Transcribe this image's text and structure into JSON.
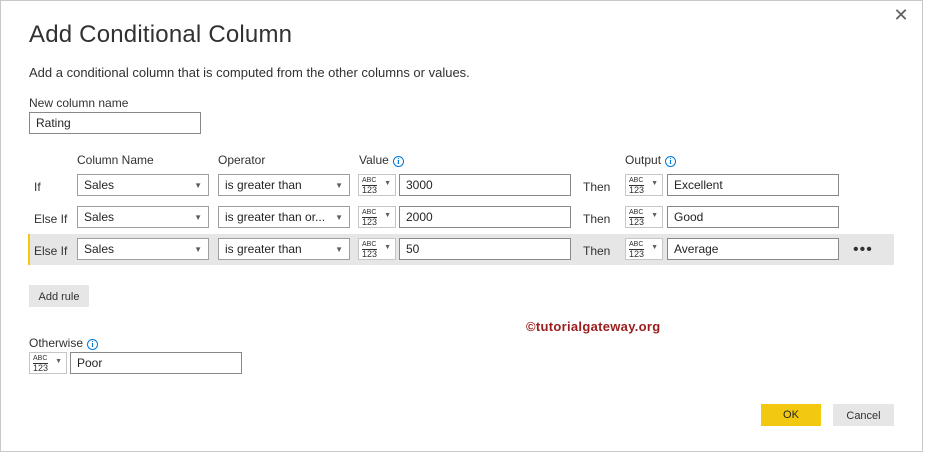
{
  "dialog": {
    "title": "Add Conditional Column",
    "description": "Add a conditional column that is computed from the other columns or values.",
    "close_glyph": "✕"
  },
  "new_column": {
    "label": "New column name",
    "value": "Rating"
  },
  "headers": {
    "column_name": "Column Name",
    "operator": "Operator",
    "value": "Value",
    "output": "Output"
  },
  "type_icon": {
    "top": "ABC",
    "bottom": "123"
  },
  "rules": [
    {
      "prefix": "If",
      "column": "Sales",
      "operator": "is greater than",
      "value": "3000",
      "then": "Then",
      "output": "Excellent"
    },
    {
      "prefix": "Else If",
      "column": "Sales",
      "operator": "is greater than or...",
      "value": "2000",
      "then": "Then",
      "output": "Good"
    },
    {
      "prefix": "Else If",
      "column": "Sales",
      "operator": "is greater than",
      "value": "50",
      "then": "Then",
      "output": "Average",
      "selected": true
    }
  ],
  "more_glyph": "•••",
  "add_rule": "Add rule",
  "otherwise": {
    "label": "Otherwise",
    "value": "Poor"
  },
  "watermark": "©tutorialgateway.org",
  "buttons": {
    "ok": "OK",
    "cancel": "Cancel"
  },
  "colors": {
    "accent": "#f2c811",
    "info": "#0078d4",
    "watermark": "#9b1c1c",
    "selected_row": "#e6e6e6"
  },
  "icons": {
    "close": "close-icon",
    "info": "info-icon",
    "caret": "chevron-down-icon",
    "type": "any-type-icon",
    "more": "more-options-icon"
  }
}
